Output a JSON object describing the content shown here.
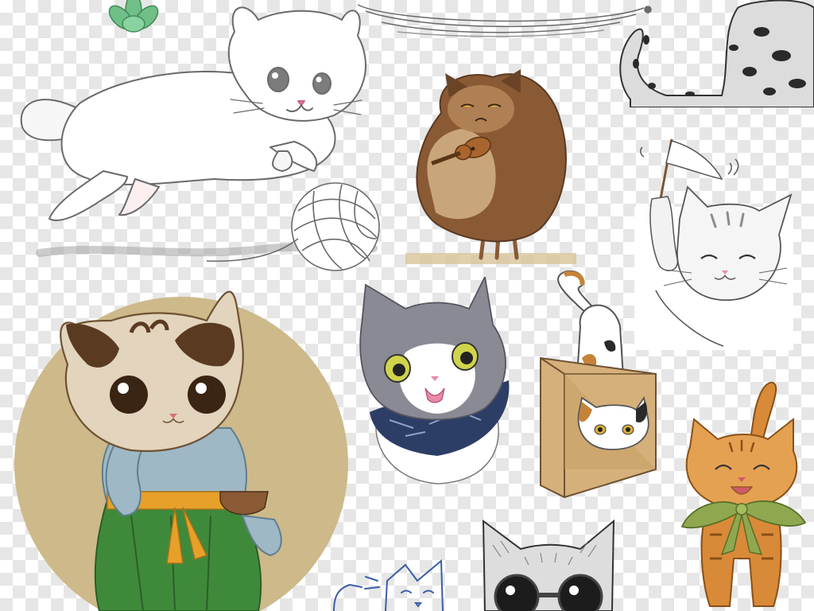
{
  "canvas": {
    "checker_light": "#ffffff",
    "checker_dark": "#e6e6e6"
  },
  "palette": {
    "pencil": "#555555",
    "brown_cat": "#8a5a35",
    "hanfu_green": "#3f8a3a",
    "hanfu_circle": "#cdb98a",
    "orange_tabby": "#d88a38",
    "bow_green": "#8fa850",
    "box_tan": "#d6b07a",
    "bandana_navy": "#2d3e66",
    "succulent": "#6fbf87"
  },
  "stickers": [
    {
      "name": "succulent-plant",
      "icon": "succulent-icon"
    },
    {
      "name": "pencil-white-cat-with-yarn",
      "icon": "leaping-cat-icon"
    },
    {
      "name": "pencil-sketch-dish",
      "icon": "dish-icon"
    },
    {
      "name": "spotted-cat-tail",
      "icon": "spotted-cat-icon"
    },
    {
      "name": "grumpy-cat-violin",
      "icon": "violin-cat-icon"
    },
    {
      "name": "tabby-kitten-flag",
      "icon": "flag-kitten-icon"
    },
    {
      "name": "hanfu-cat-girl",
      "icon": "hanfu-cat-icon"
    },
    {
      "name": "gray-cat-bandana",
      "icon": "bandana-cat-icon"
    },
    {
      "name": "calico-cat-in-box",
      "icon": "box-cat-icon"
    },
    {
      "name": "orange-tabby-bow",
      "icon": "tabby-bow-cat-icon"
    },
    {
      "name": "cat-sunglasses-sketch",
      "icon": "sunglasses-cat-icon"
    },
    {
      "name": "blue-outline-cat",
      "icon": "outline-cat-icon"
    }
  ]
}
